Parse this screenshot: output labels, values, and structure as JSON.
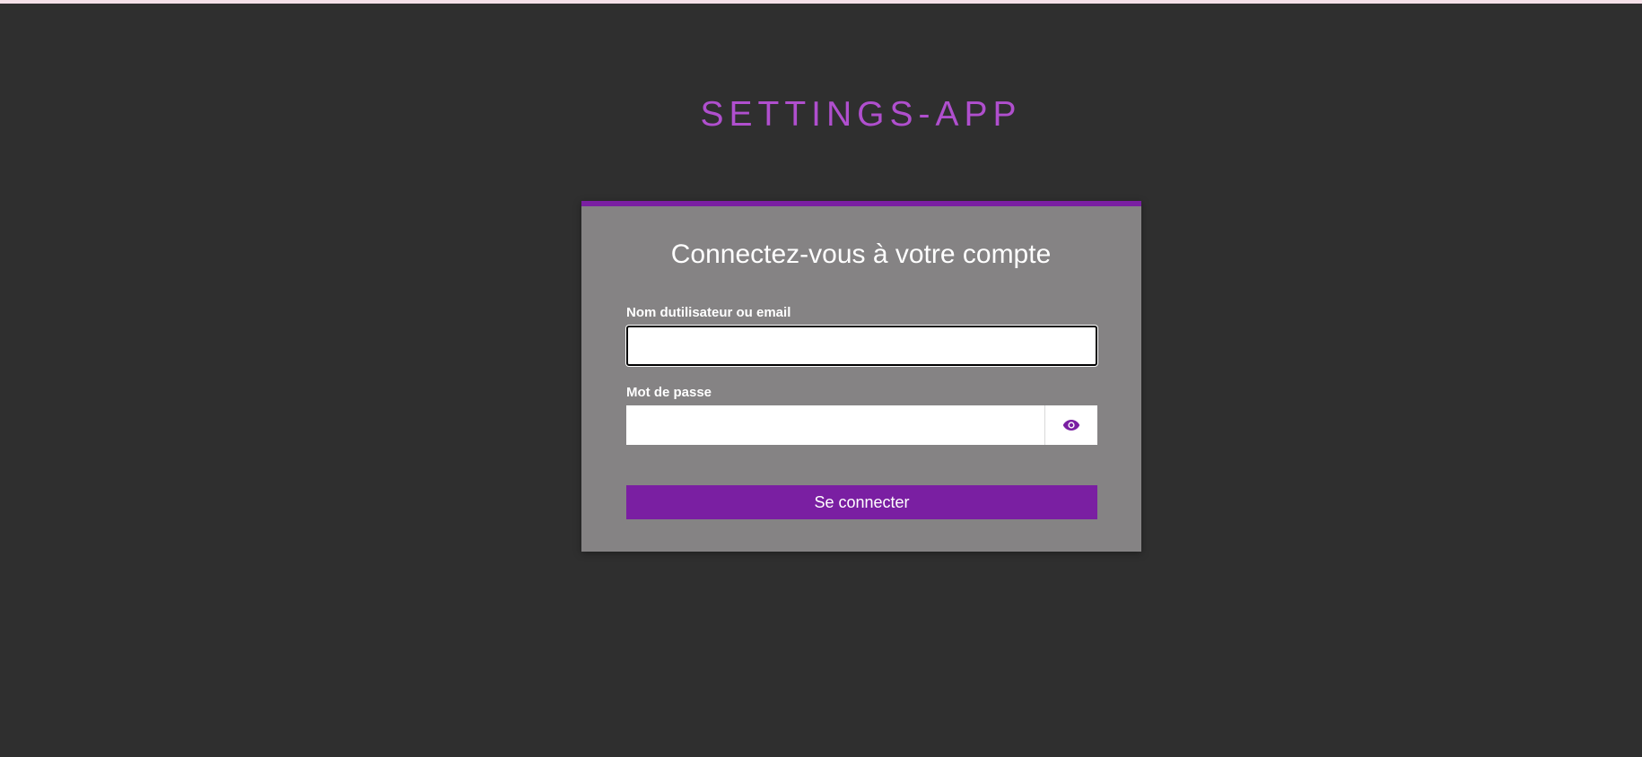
{
  "app": {
    "title": "SETTINGS-APP"
  },
  "login_card": {
    "heading": "Connectez-vous à votre compte",
    "username": {
      "label": "Nom dutilisateur ou email",
      "value": "",
      "placeholder": ""
    },
    "password": {
      "label": "Mot de passe",
      "value": "",
      "placeholder": "",
      "toggle_icon": "eye-icon"
    },
    "submit_label": "Se connecter"
  },
  "colors": {
    "background": "#2f2f2f",
    "card": "#858384",
    "accent": "#7a1fa2",
    "title": "#b04fce"
  }
}
